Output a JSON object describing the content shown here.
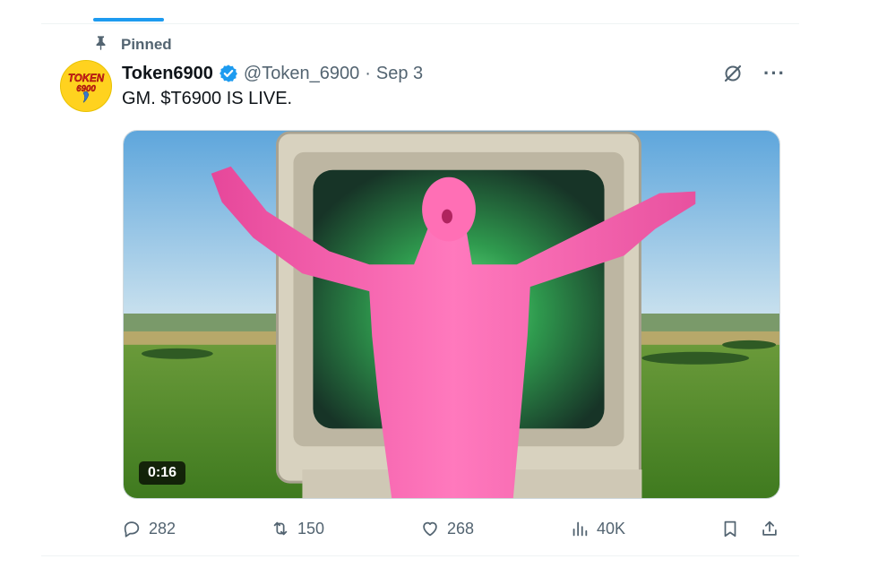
{
  "pinned_label": "Pinned",
  "author": {
    "display_name": "Token6900",
    "handle": "@Token_6900",
    "separator": "·",
    "date": "Sep 3",
    "verified": true,
    "avatar_text": "TOKEN 6900"
  },
  "tweet": {
    "text": "GM. $T6900 IS LIVE."
  },
  "media": {
    "type": "video",
    "duration": "0:16"
  },
  "stats": {
    "replies": "282",
    "reposts": "150",
    "likes": "268",
    "views": "40K"
  },
  "icons": {
    "pin": "pin-icon",
    "verified": "verified-badge-icon",
    "grok": "grok-icon",
    "more": "more-icon",
    "reply": "reply-icon",
    "repost": "repost-icon",
    "like": "heart-icon",
    "views": "views-icon",
    "bookmark": "bookmark-icon",
    "share": "share-icon"
  },
  "colors": {
    "accent": "#1d9bf0",
    "text": "#0f1419",
    "muted": "#536471"
  }
}
